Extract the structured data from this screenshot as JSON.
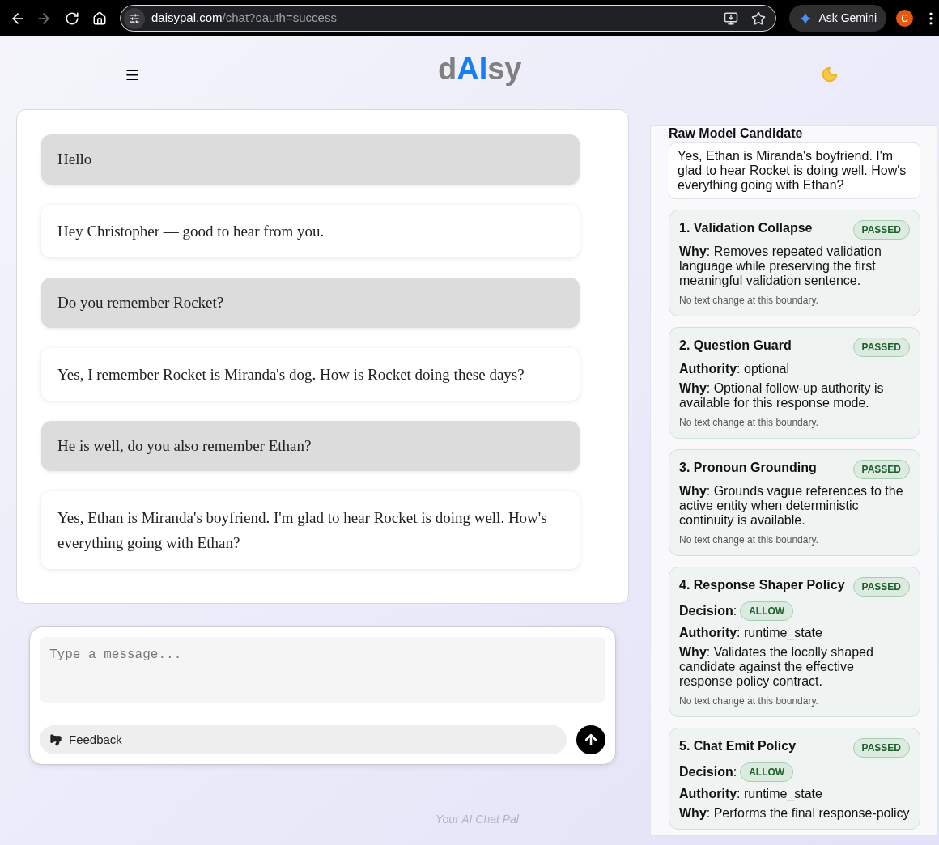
{
  "browser": {
    "url_host": "daisypal.com",
    "url_path": "/chat?oauth=success",
    "back_disabled": false,
    "forward_disabled": true,
    "gemini_button": "Ask Gemini",
    "profile_initial": "C"
  },
  "header": {
    "logo": [
      {
        "text": "d",
        "highlighted": false
      },
      {
        "text": "AI",
        "highlighted": true
      },
      {
        "text": "sy",
        "highlighted": false
      }
    ]
  },
  "messages": [
    {
      "kind": "user",
      "text": "Hello"
    },
    {
      "kind": "assistant",
      "text": "Hey Christopher — good to hear from you."
    },
    {
      "kind": "user",
      "text": "Do you remember Rocket?"
    },
    {
      "kind": "assistant",
      "text": "Yes, I remember Rocket is Miranda's dog. How is Rocket doing these days?"
    },
    {
      "kind": "user",
      "text": "He is well, do you also remember Ethan?"
    },
    {
      "kind": "assistant",
      "text": "Yes, Ethan is Miranda's boyfriend. I'm glad to hear Rocket is doing well. How's everything going with Ethan?"
    }
  ],
  "composer": {
    "placeholder": "Type a message...",
    "feedback_button": "Feedback"
  },
  "footer": "Your AI Chat Pal",
  "debug_panel": {
    "raw_title": "Raw Model Candidate",
    "raw_text": "Yes, Ethan is Miranda's boyfriend. I'm glad to hear Rocket is doing well. How's everything going with Ethan?",
    "stages": [
      {
        "title": "1. Validation Collapse",
        "status": "PASSED",
        "fields": [
          {
            "kind": "text",
            "text": "**Why**: Removes repeated validation language while preserving the first meaningful validation sentence."
          }
        ],
        "note": "No text change at this boundary."
      },
      {
        "title": "2. Question Guard",
        "status": "PASSED",
        "fields": [
          {
            "kind": "text",
            "text": "**Authority**: optional"
          },
          {
            "kind": "text",
            "text": "**Why**: Optional follow-up authority is available for this response mode."
          }
        ],
        "note": "No text change at this boundary."
      },
      {
        "title": "3. Pronoun Grounding",
        "status": "PASSED",
        "fields": [
          {
            "kind": "text",
            "text": "**Why**: Grounds vague references to the active entity when deterministic continuity is available."
          }
        ],
        "note": "No text change at this boundary."
      },
      {
        "title": "4. Response Shaper Policy",
        "status": "PASSED",
        "fields": [
          {
            "kind": "badge",
            "label": "**Decision**:",
            "value": "ALLOW"
          },
          {
            "kind": "text",
            "text": "**Authority**: runtime_state"
          },
          {
            "kind": "text",
            "text": "**Why**: Validates the locally shaped candidate against the effective response policy contract."
          }
        ],
        "note": "No text change at this boundary."
      },
      {
        "title": "5. Chat Emit Policy",
        "status": "PASSED",
        "fields": [
          {
            "kind": "badge",
            "label": "**Decision**:",
            "value": "ALLOW"
          },
          {
            "kind": "text",
            "text": "**Authority**: runtime_state"
          },
          {
            "kind": "text",
            "text": "**Why**: Performs the final response-policy"
          }
        ]
      }
    ]
  }
}
